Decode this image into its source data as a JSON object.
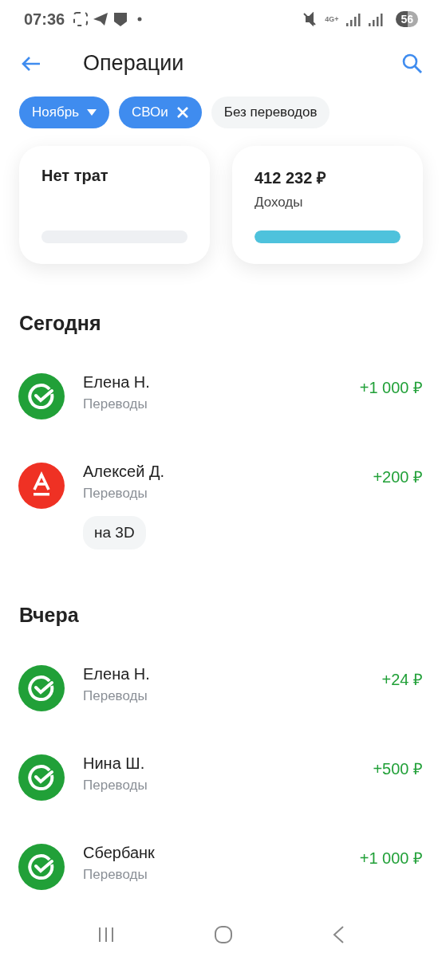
{
  "status_bar": {
    "time": "07:36",
    "network": "4G+",
    "battery": "56"
  },
  "header": {
    "title": "Операции"
  },
  "filters": [
    {
      "label": "Ноябрь",
      "kind": "dropdown",
      "selected": true
    },
    {
      "label": "СВОи",
      "kind": "removable",
      "selected": true
    },
    {
      "label": "Без переводов",
      "kind": "plain",
      "selected": false
    }
  ],
  "summary": [
    {
      "title": "Нет трат",
      "level": 0
    },
    {
      "title": "412 232 ₽",
      "subtitle": "Доходы",
      "level": 1
    }
  ],
  "sections": [
    {
      "title": "Сегодня",
      "items": [
        {
          "name": "Елена Н.",
          "category": "Переводы",
          "amount": "+1 000 ₽",
          "kind": "sber"
        },
        {
          "name": "Алексей Д.",
          "category": "Переводы",
          "amount": "+200 ₽",
          "kind": "alfa",
          "comment": "на 3D"
        }
      ]
    },
    {
      "title": "Вчера",
      "items": [
        {
          "name": "Елена Н.",
          "category": "Переводы",
          "amount": "+24 ₽",
          "kind": "sber"
        },
        {
          "name": "Нина Ш.",
          "category": "Переводы",
          "amount": "+500 ₽",
          "kind": "sber"
        },
        {
          "name": "Сбербанк",
          "category": "Переводы",
          "amount": "+1 000 ₽",
          "kind": "sber"
        }
      ]
    }
  ]
}
